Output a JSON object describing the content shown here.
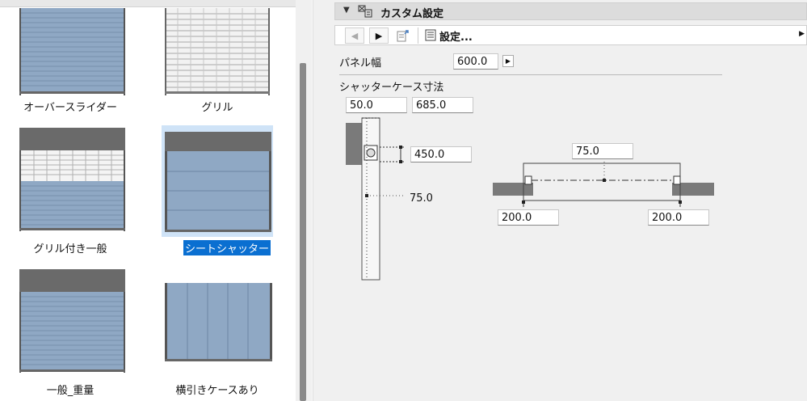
{
  "gallery": {
    "items": [
      {
        "label": "オーバースライダー",
        "selected": false
      },
      {
        "label": "グリル",
        "selected": false
      },
      {
        "label": "グリル付き一般",
        "selected": false
      },
      {
        "label": "シートシャッター",
        "selected": true
      },
      {
        "label": "一般_重量",
        "selected": false
      },
      {
        "label": "横引きケースあり",
        "selected": false
      }
    ]
  },
  "panel": {
    "header_title": "カスタム設定",
    "nav": {
      "dropdown_label": "設定..."
    },
    "panel_width": {
      "label": "パネル幅",
      "value": "600.0"
    },
    "case_dims": {
      "label": "シャッターケース寸法",
      "val_a": "50.0",
      "val_b": "685.0",
      "val_c": "450.0",
      "val_d": "75.0",
      "val_e": "75.0",
      "val_f": "200.0",
      "val_g": "200.0"
    }
  },
  "colors": {
    "shutter_blue": "#8fa8c4",
    "case_gray": "#6a6a6a",
    "selection": "#0a6fd1"
  }
}
